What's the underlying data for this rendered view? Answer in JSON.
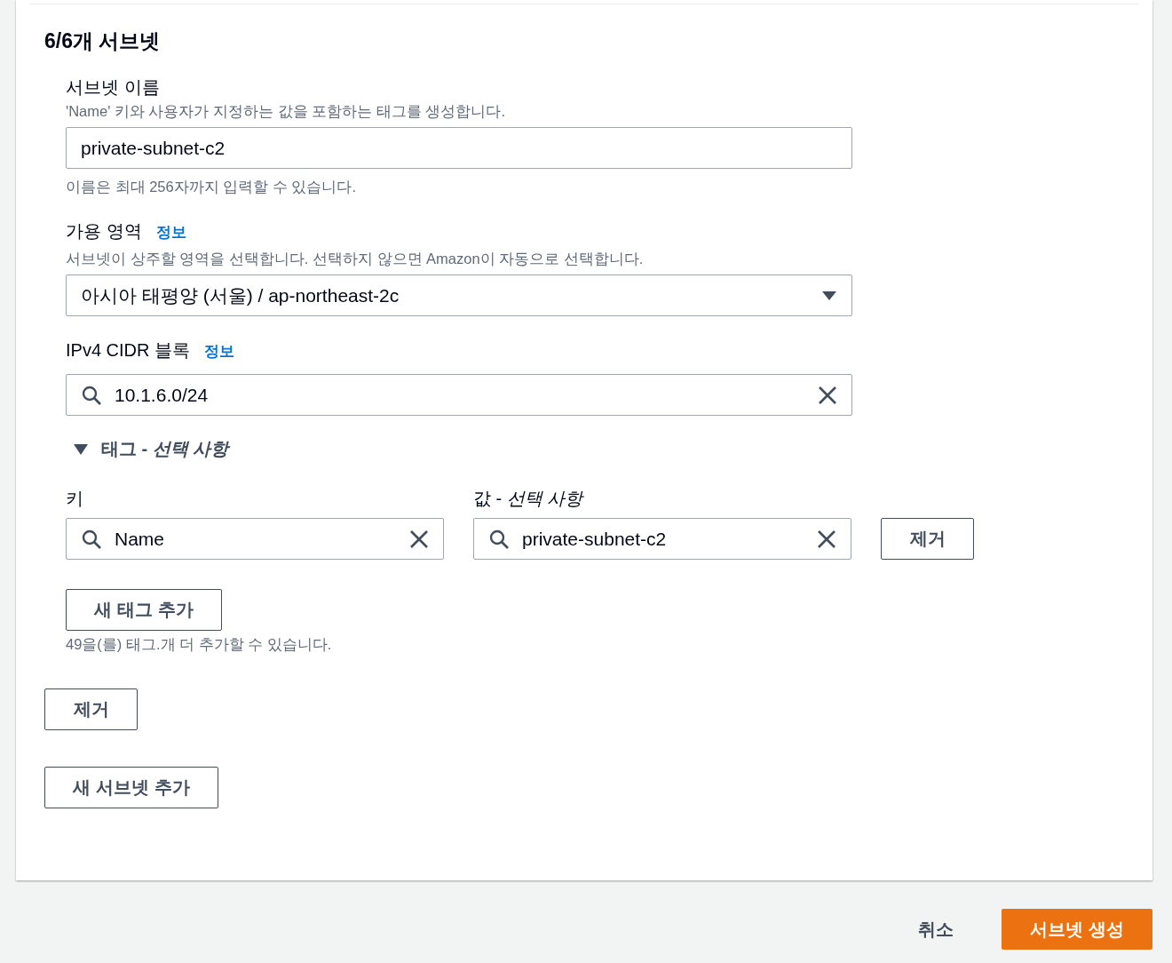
{
  "section": {
    "heading": "6/6개 서브넷",
    "subnet_name": {
      "label": "서브넷 이름",
      "description": "'Name' 키와 사용자가 지정하는 값을 포함하는 태그를 생성합니다.",
      "value": "private-subnet-c2",
      "constraint": "이름은 최대 256자까지 입력할 수 있습니다."
    },
    "availability_zone": {
      "label": "가용 영역",
      "info_link": "정보",
      "description": "서브넷이 상주할 영역을 선택합니다. 선택하지 않으면 Amazon이 자동으로 선택합니다.",
      "value": "아시아 태평양 (서울) / ap-northeast-2c"
    },
    "cidr": {
      "label": "IPv4 CIDR 블록",
      "info_link": "정보",
      "value": "10.1.6.0/24"
    },
    "tags": {
      "title": "태그 - *선택 사항*",
      "expanded": true,
      "key_label": "키",
      "value_label": "값 - *선택 사항*",
      "rows": [
        {
          "key": "Name",
          "value": "private-subnet-c2",
          "remove_button": "제거"
        }
      ],
      "add_button": "새 태그 추가",
      "limit_note": "49을(를) 태그.개 더 추가할 수 있습니다."
    },
    "remove_button": "제거",
    "add_subnet_button": "새 서브넷 추가"
  },
  "footer": {
    "cancel": "취소",
    "submit": "서브넷 생성"
  }
}
